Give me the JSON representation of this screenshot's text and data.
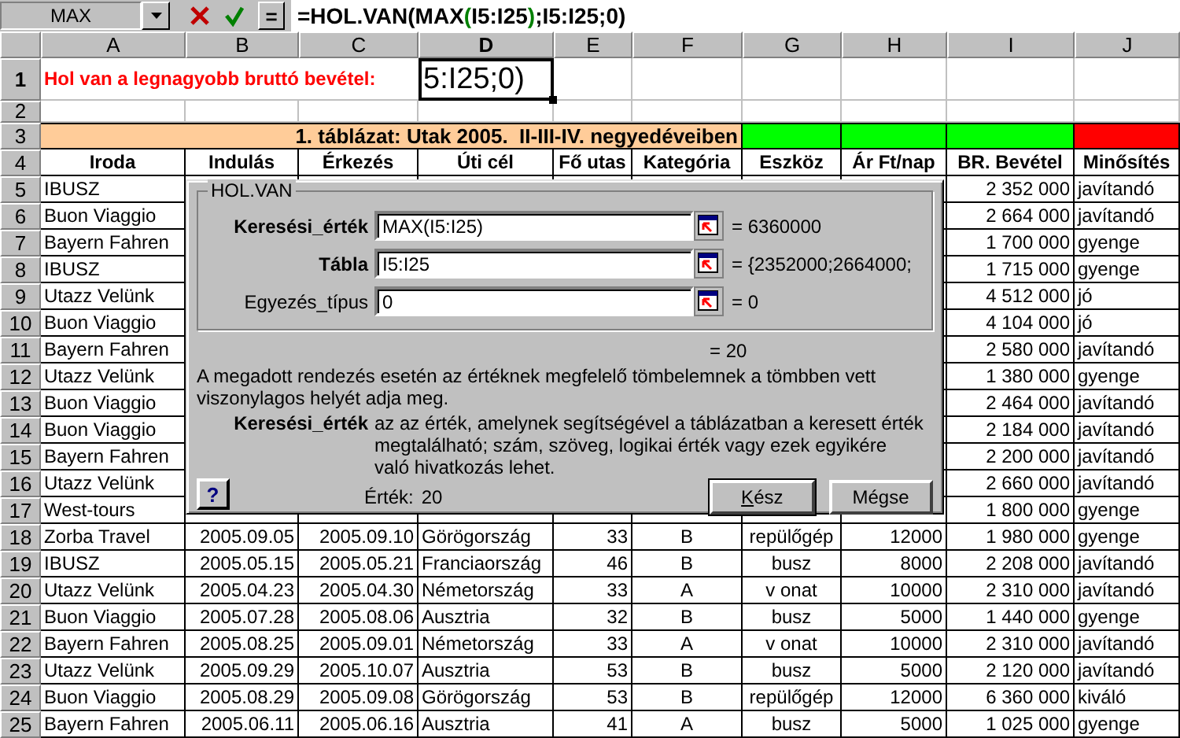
{
  "formula_bar": {
    "name_box": "MAX",
    "edit_button": "=",
    "formula": [
      {
        "text": "=HOL.VAN(MAX"
      },
      {
        "text": "(",
        "color": "#008000"
      },
      {
        "text": "I5:I25"
      },
      {
        "text": ")",
        "color": "#008000"
      },
      {
        "text": ";I5:I25;0)"
      }
    ]
  },
  "sheet": {
    "columns": [
      {
        "label": "A",
        "selected": false
      },
      {
        "label": "B",
        "selected": false
      },
      {
        "label": "C",
        "selected": false
      },
      {
        "label": "D",
        "selected": true
      },
      {
        "label": "E",
        "selected": false
      },
      {
        "label": "F",
        "selected": false
      },
      {
        "label": "G",
        "selected": false
      },
      {
        "label": "H",
        "selected": false
      },
      {
        "label": "I",
        "selected": false
      },
      {
        "label": "J",
        "selected": false
      }
    ],
    "rows": [
      {
        "number": "1",
        "selected": true,
        "kind": "title",
        "title": "Hol van a legnagyobb bruttó bevétel:",
        "active_cell": "5:I25;0)"
      },
      {
        "number": "2",
        "selected": false,
        "kind": "blank"
      },
      {
        "number": "3",
        "selected": false,
        "kind": "band",
        "caption": "1. táblázat: Utak 2005.  II-III-IV. negyedéveiben",
        "markers": [
          {
            "color": "#00ff00"
          },
          {
            "color": "#00ff00"
          },
          {
            "color": "#00ff00"
          },
          {
            "color": "#ff0000"
          }
        ]
      },
      {
        "number": "4",
        "selected": false,
        "kind": "header",
        "cells": [
          "Iroda",
          "Indulás",
          "Érkezés",
          "Úti cél",
          "Fő utas",
          "Kategória",
          "Eszköz",
          "Ár Ft/nap",
          "BR. Bevétel",
          "Minősítés"
        ]
      },
      {
        "number": "5",
        "selected": false,
        "kind": "data",
        "cells": [
          "IBUSZ",
          null,
          null,
          null,
          null,
          null,
          null,
          null,
          "2 352 000",
          "javítandó"
        ]
      },
      {
        "number": "6",
        "selected": false,
        "kind": "data",
        "cells": [
          "Buon Viaggio",
          null,
          null,
          null,
          null,
          null,
          null,
          null,
          "2 664 000",
          "javítandó"
        ]
      },
      {
        "number": "7",
        "selected": false,
        "kind": "data",
        "cells": [
          "Bayern Fahren",
          null,
          null,
          null,
          null,
          null,
          null,
          null,
          "1 700 000",
          "gyenge"
        ]
      },
      {
        "number": "8",
        "selected": false,
        "kind": "data",
        "cells": [
          "IBUSZ",
          null,
          null,
          null,
          null,
          null,
          null,
          null,
          "1 715 000",
          "gyenge"
        ]
      },
      {
        "number": "9",
        "selected": false,
        "kind": "data",
        "cells": [
          "Utazz Velünk",
          null,
          null,
          null,
          null,
          null,
          null,
          null,
          "4 512 000",
          "jó"
        ]
      },
      {
        "number": "10",
        "selected": false,
        "kind": "data",
        "cells": [
          "Buon Viaggio",
          null,
          null,
          null,
          null,
          null,
          null,
          null,
          "4 104 000",
          "jó"
        ]
      },
      {
        "number": "11",
        "selected": false,
        "kind": "data",
        "cells": [
          "Bayern Fahren",
          null,
          null,
          null,
          null,
          null,
          null,
          null,
          "2 580 000",
          "javítandó"
        ]
      },
      {
        "number": "12",
        "selected": false,
        "kind": "data",
        "cells": [
          "Utazz Velünk",
          null,
          null,
          null,
          null,
          null,
          null,
          null,
          "1 380 000",
          "gyenge"
        ]
      },
      {
        "number": "13",
        "selected": false,
        "kind": "data",
        "cells": [
          "Buon Viaggio",
          null,
          null,
          null,
          null,
          null,
          null,
          null,
          "2 464 000",
          "javítandó"
        ]
      },
      {
        "number": "14",
        "selected": false,
        "kind": "data",
        "cells": [
          "Buon Viaggio",
          null,
          null,
          null,
          null,
          null,
          null,
          null,
          "2 184 000",
          "javítandó"
        ]
      },
      {
        "number": "15",
        "selected": false,
        "kind": "data",
        "cells": [
          "Bayern Fahren",
          null,
          null,
          null,
          null,
          null,
          null,
          null,
          "2 200 000",
          "javítandó"
        ]
      },
      {
        "number": "16",
        "selected": false,
        "kind": "data",
        "cells": [
          "Utazz Velünk",
          null,
          null,
          null,
          null,
          null,
          null,
          null,
          "2 660 000",
          "javítandó"
        ]
      },
      {
        "number": "17",
        "selected": false,
        "kind": "data",
        "cells": [
          "West-tours",
          null,
          null,
          null,
          null,
          null,
          null,
          null,
          "1 800 000",
          "gyenge"
        ]
      },
      {
        "number": "18",
        "selected": false,
        "kind": "data",
        "cells": [
          "Zorba Travel",
          "2005.09.05",
          "2005.09.10",
          "Görögország",
          "33",
          "B",
          "repülőgép",
          "12000",
          "1 980 000",
          "gyenge"
        ]
      },
      {
        "number": "19",
        "selected": false,
        "kind": "data",
        "cells": [
          "IBUSZ",
          "2005.05.15",
          "2005.05.21",
          "Franciaország",
          "46",
          "B",
          "busz",
          "8000",
          "2 208 000",
          "javítandó"
        ]
      },
      {
        "number": "20",
        "selected": false,
        "kind": "data",
        "cells": [
          "Utazz Velünk",
          "2005.04.23",
          "2005.04.30",
          "Németország",
          "33",
          "A",
          "v onat",
          "10000",
          "2 310 000",
          "javítandó"
        ]
      },
      {
        "number": "21",
        "selected": false,
        "kind": "data",
        "cells": [
          "Buon Viaggio",
          "2005.07.28",
          "2005.08.06",
          "Ausztria",
          "32",
          "B",
          "busz",
          "5000",
          "1 440 000",
          "gyenge"
        ]
      },
      {
        "number": "22",
        "selected": false,
        "kind": "data",
        "cells": [
          "Bayern Fahren",
          "2005.08.25",
          "2005.09.01",
          "Németország",
          "33",
          "A",
          "v onat",
          "10000",
          "2 310 000",
          "javítandó"
        ]
      },
      {
        "number": "23",
        "selected": false,
        "kind": "data",
        "cells": [
          "Utazz Velünk",
          "2005.09.29",
          "2005.10.07",
          "Ausztria",
          "53",
          "B",
          "busz",
          "5000",
          "2 120 000",
          "javítandó"
        ]
      },
      {
        "number": "24",
        "selected": false,
        "kind": "data",
        "cells": [
          "Buon Viaggio",
          "2005.08.29",
          "2005.09.08",
          "Görögország",
          "53",
          "B",
          "repülőgép",
          "12000",
          "6 360 000",
          "kiváló"
        ]
      },
      {
        "number": "25",
        "selected": false,
        "kind": "data",
        "cells": [
          "Bayern Fahren",
          "2005.06.11",
          "2005.06.16",
          "Ausztria",
          "41",
          "A",
          "busz",
          "5000",
          "1 025 000",
          "gyenge"
        ]
      }
    ]
  },
  "dialog": {
    "group_title": "HOL.VAN",
    "arguments": [
      {
        "label": "Keresési_érték",
        "required": true,
        "value": "MAX(I5:I25)",
        "result": "= 6360000"
      },
      {
        "label": "Tábla",
        "required": true,
        "value": "I5:I25",
        "result": "= {2352000;2664000;"
      },
      {
        "label": "Egyezés_típus",
        "required": false,
        "value": "0",
        "result": "= 0"
      }
    ],
    "formula_result": "= 20",
    "description": "A megadott rendezés esetén az értéknek megfelelő tömbelemnek a tömbben vett viszonylagos helyét adja meg.",
    "argument_name": "Keresési_érték",
    "argument_help": "az az érték, amelynek segítségével a táblázatban a keresett érték megtalálható; szám, szöveg, logikai érték vagy ezek egyikére való hivatkozás lehet.",
    "help_button": "?",
    "value_label": "Érték:",
    "value": "20",
    "buttons": [
      {
        "label": "Kész",
        "default": true,
        "mnemonic": true
      },
      {
        "label": "Mégse",
        "default": false
      }
    ]
  }
}
